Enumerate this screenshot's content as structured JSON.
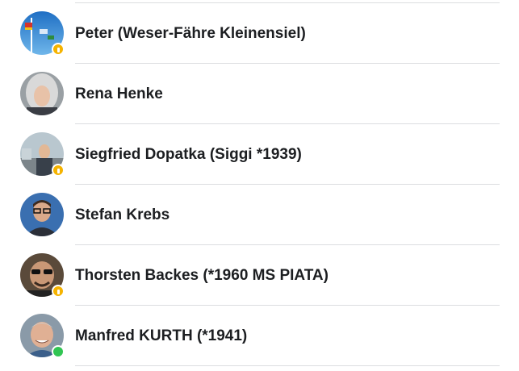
{
  "contacts": [
    {
      "name": "Peter (Weser-Fähre Kleinensiel)",
      "badge": "gold",
      "avatar": "photo-sky-flags"
    },
    {
      "name": "Rena Henke",
      "badge": "none",
      "avatar": "photo-woman-gray-hair"
    },
    {
      "name": "Siegfried Dopatka (Siggi *1939)",
      "badge": "gold",
      "avatar": "photo-man-harbor"
    },
    {
      "name": "Stefan Krebs",
      "badge": "none",
      "avatar": "photo-man-glasses"
    },
    {
      "name": "Thorsten Backes (*1960 MS PIATA)",
      "badge": "gold",
      "avatar": "photo-man-sunglasses"
    },
    {
      "name": "Manfred KURTH (*1941)",
      "badge": "green",
      "avatar": "photo-man-smiling"
    }
  ],
  "colors": {
    "text": "#1c1e21",
    "separator": "#dcdde0",
    "badge_gold": "#f5b300",
    "badge_online": "#31c553"
  }
}
